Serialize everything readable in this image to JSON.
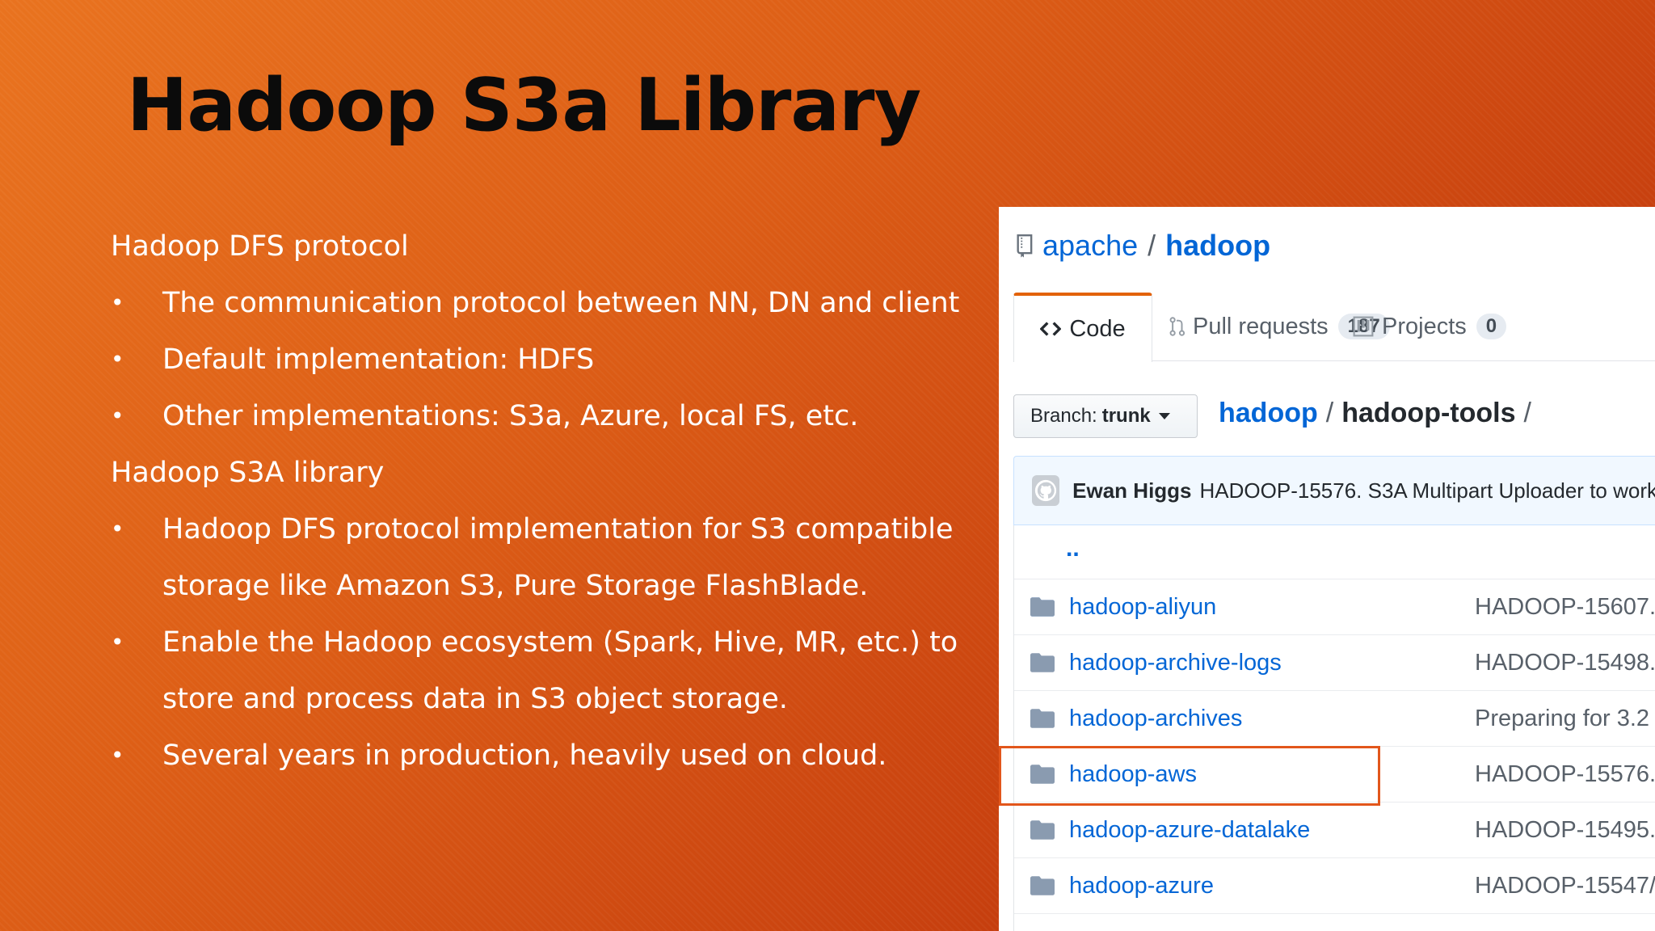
{
  "slide": {
    "title": "Hadoop S3a Library",
    "sections": [
      {
        "heading": "Hadoop DFS protocol",
        "bullets": [
          "The communication protocol between NN, DN and client",
          "Default implementation: HDFS",
          "Other implementations: S3a, Azure, local FS, etc."
        ]
      },
      {
        "heading": "Hadoop S3A library",
        "bullets": [
          "Hadoop DFS protocol implementation for S3 compatible storage like Amazon S3, Pure Storage FlashBlade.",
          "Enable the Hadoop ecosystem (Spark, Hive, MR, etc.) to store and process data in S3 object storage.",
          "Several years in production, heavily used on cloud."
        ]
      }
    ],
    "bullet_glyph": "•"
  },
  "github": {
    "owner": "apache",
    "separator": "/",
    "repo": "hadoop",
    "tabs": [
      {
        "label": "Code",
        "icon": "code-icon"
      },
      {
        "label": "Pull requests",
        "count": "187",
        "icon": "pull-request-icon"
      },
      {
        "label": "Projects",
        "count": "0",
        "icon": "project-icon"
      }
    ],
    "branch": {
      "prefix": "Branch:",
      "value": "trunk"
    },
    "breadcrumb": {
      "root": "hadoop",
      "current": "hadoop-tools",
      "sep": "/"
    },
    "commit": {
      "author": "Ewan Higgs",
      "message": "HADOOP-15576. S3A Multipart Uploader to work"
    },
    "parent_dir": "..",
    "files": [
      {
        "name": "hadoop-aliyun",
        "message": "HADOOP-15607."
      },
      {
        "name": "hadoop-archive-logs",
        "message": "HADOOP-15498."
      },
      {
        "name": "hadoop-archives",
        "message": "Preparing for 3.2"
      },
      {
        "name": "hadoop-aws",
        "message": "HADOOP-15576."
      },
      {
        "name": "hadoop-azure-datalake",
        "message": "HADOOP-15495."
      },
      {
        "name": "hadoop-azure",
        "message": "HADOOP-15547/"
      }
    ],
    "highlighted_file": "hadoop-aws",
    "colors": {
      "link": "#0366d6",
      "active_tab_accent": "#e36209",
      "highlight": "#e2561b"
    }
  }
}
